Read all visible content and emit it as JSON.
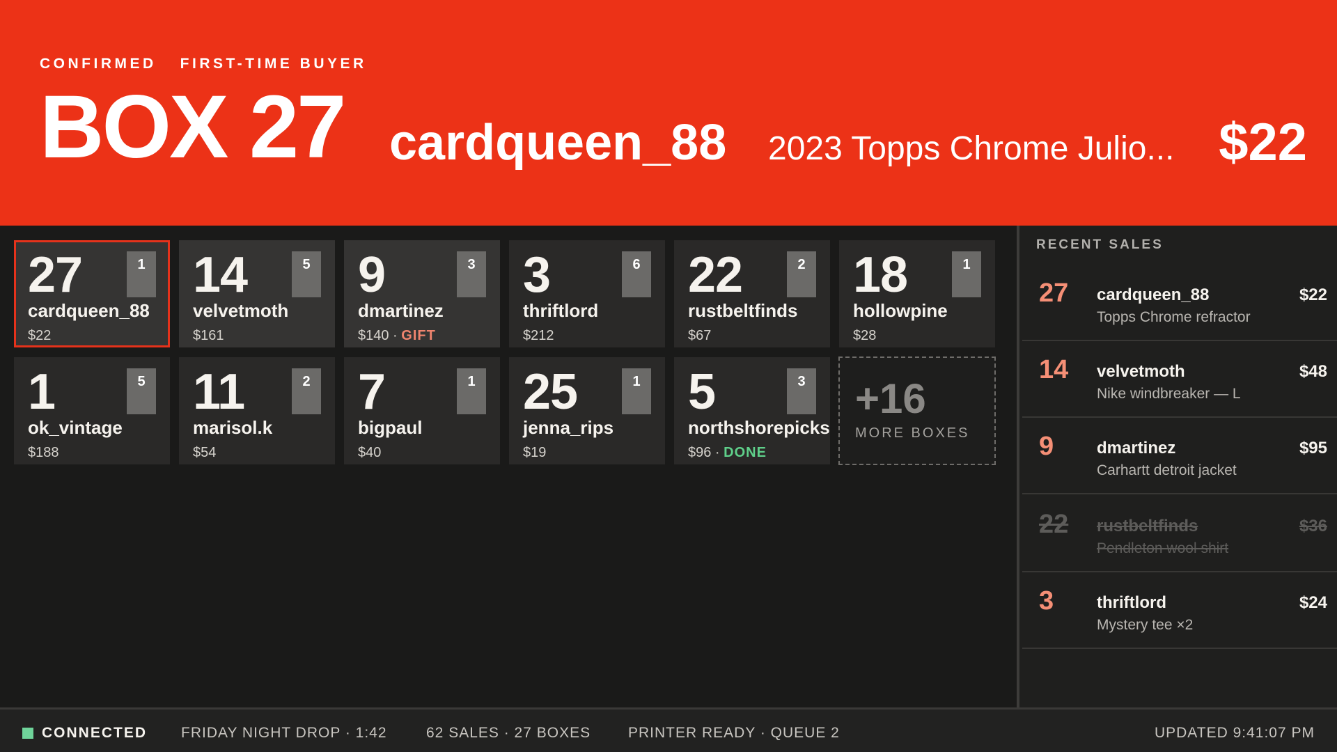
{
  "header": {
    "status_tag": "CONFIRMED",
    "buyer_tag": "FIRST-TIME BUYER",
    "box_title": "BOX 27",
    "buyer_name": "cardqueen_88",
    "item_title": "2023 Topps Chrome Julio...",
    "price": "$22"
  },
  "boxes": [
    {
      "number": "27",
      "badge": "1",
      "name": "cardqueen_88",
      "price": "$22",
      "note": ""
    },
    {
      "number": "14",
      "badge": "5",
      "name": "velvetmoth",
      "price": "$161",
      "note": ""
    },
    {
      "number": "9",
      "badge": "3",
      "name": "dmartinez",
      "price": "$140 · ",
      "note": "GIFT"
    },
    {
      "number": "3",
      "badge": "6",
      "name": "thriftlord",
      "price": "$212",
      "note": ""
    },
    {
      "number": "22",
      "badge": "2",
      "name": "rustbeltfinds",
      "price": "$67",
      "note": ""
    },
    {
      "number": "18",
      "badge": "1",
      "name": "hollowpine",
      "price": "$28",
      "note": ""
    },
    {
      "number": "1",
      "badge": "5",
      "name": "ok_vintage",
      "price": "$188",
      "note": ""
    },
    {
      "number": "11",
      "badge": "2",
      "name": "marisol.k",
      "price": "$54",
      "note": ""
    },
    {
      "number": "7",
      "badge": "1",
      "name": "bigpaul",
      "price": "$40",
      "note": ""
    },
    {
      "number": "25",
      "badge": "1",
      "name": "jenna_rips",
      "price": "$19",
      "note": ""
    },
    {
      "number": "5",
      "badge": "3",
      "name": "northshorepicks",
      "price": "$96 · ",
      "note": "DONE"
    }
  ],
  "more_boxes": {
    "count": "+16",
    "label": "MORE BOXES"
  },
  "recent_sales": {
    "title": "RECENT SALES",
    "items": [
      {
        "box": "27",
        "buyer": "cardqueen_88",
        "item": "Topps Chrome refractor",
        "price": "$22",
        "voided": false
      },
      {
        "box": "14",
        "buyer": "velvetmoth",
        "item": "Nike windbreaker — L",
        "price": "$48",
        "voided": false
      },
      {
        "box": "9",
        "buyer": "dmartinez",
        "item": "Carhartt detroit jacket",
        "price": "$95",
        "voided": false
      },
      {
        "box": "22",
        "buyer": "rustbeltfinds",
        "item": "Pendleton wool shirt",
        "price": "$36",
        "voided": true
      },
      {
        "box": "3",
        "buyer": "thriftlord",
        "item": "Mystery tee ×2",
        "price": "$24",
        "voided": false
      }
    ]
  },
  "footer": {
    "connection": "CONNECTED",
    "show": "FRIDAY NIGHT DROP · 1:42",
    "stats": "62 SALES · 27 BOXES",
    "printer": "PRINTER READY · QUEUE 2",
    "updated": "UPDATED 9:41:07 PM"
  },
  "colors": {
    "accent": "#ec3217",
    "connected": "#6fd49a",
    "gift": "#f0846e",
    "done": "#5fd08a",
    "sale_number": "#f58f76"
  }
}
